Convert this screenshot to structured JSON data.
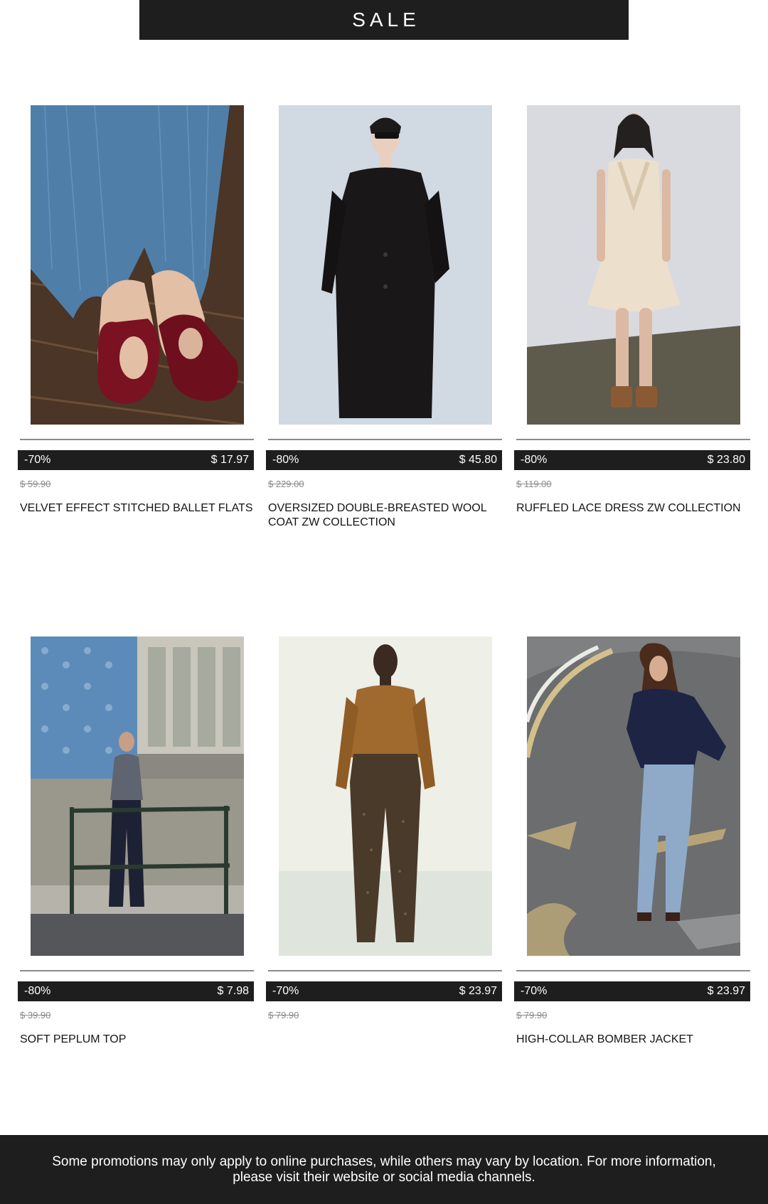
{
  "banner": {
    "title": "SALE"
  },
  "products": [
    {
      "image": "ballet-flats-photo",
      "discount": "-70%",
      "price": "$ 17.97",
      "old_price": "$ 59.90",
      "name": "VELVET EFFECT STITCHED BALLET FLATS"
    },
    {
      "image": "wool-coat-photo",
      "discount": "-80%",
      "price": "$ 45.80",
      "old_price": "$ 229.00",
      "name": "OVERSIZED DOUBLE-BREASTED WOOL COAT ZW COLLECTION"
    },
    {
      "image": "lace-dress-photo",
      "discount": "-80%",
      "price": "$ 23.80",
      "old_price": "$ 119.00",
      "name": "RUFFLED LACE DRESS ZW COLLECTION"
    },
    {
      "image": "peplum-top-photo",
      "discount": "-80%",
      "price": "$ 7.98",
      "old_price": "$ 39.90",
      "name": "SOFT PEPLUM TOP"
    },
    {
      "image": "satin-shirt-sequin-trousers-photo",
      "discount": "-70%",
      "price": "$ 23.97",
      "old_price": "$ 79.90",
      "name": ""
    },
    {
      "image": "bomber-jacket-photo",
      "discount": "-70%",
      "price": "$ 23.97",
      "old_price": "$ 79.90",
      "name": "HIGH-COLLAR BOMBER JACKET"
    }
  ],
  "footer": {
    "text": "Some promotions may only apply to online purchases, while others may vary by location. For more information, please visit their website or social media channels."
  },
  "colors": {
    "dark": "#1e1e1e",
    "background": "#ffffff",
    "old_price": "#8b8b8b"
  }
}
